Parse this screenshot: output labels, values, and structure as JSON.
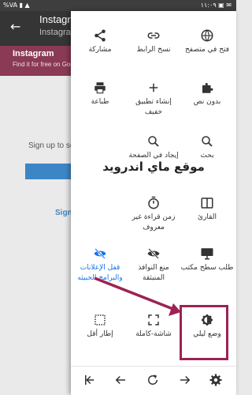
{
  "status_bar": {
    "left": "%VA ▮ ▲",
    "right": "١١:٠٩ ▣ ✉"
  },
  "background": {
    "title": "Instagram",
    "subtitle": "Instagram",
    "banner_title": "Instagram",
    "banner_sub": "Find it for free on Google Play",
    "signup": "Sign up to see",
    "link": "Sign"
  },
  "menu": {
    "items": [
      {
        "label": "مشاركة",
        "icon": "share-icon"
      },
      {
        "label": "نسخ الرابط",
        "icon": "link-icon"
      },
      {
        "label": "فتح في متصفح",
        "icon": "globe-icon"
      },
      {
        "label": "طباعة",
        "icon": "print-icon"
      },
      {
        "label": "إنشاء تطبيق خفيف",
        "icon": "add-icon"
      },
      {
        "label": "بدون نص",
        "icon": "puzzle-icon"
      },
      {
        "label": "إيجاد في الصفحة",
        "icon": "find-icon"
      },
      {
        "label": "بحث",
        "icon": "search-icon"
      },
      {
        "label": "زمن قراءة غير معروف",
        "icon": "timer-icon"
      },
      {
        "label": "القارئ",
        "icon": "reader-icon"
      },
      {
        "label": "قفل الإعلانات والبرامج الخبيثه",
        "icon": "eye-off-icon",
        "accent": "#1a73e8"
      },
      {
        "label": "منع النوافذ المنبثقة",
        "icon": "popup-block-icon"
      },
      {
        "label": "طلب سطح مكتب",
        "icon": "desktop-icon"
      },
      {
        "label": "إطار أقل",
        "icon": "frame-less-icon"
      },
      {
        "label": "شاشة-كاملة",
        "icon": "fullscreen-icon"
      },
      {
        "label": "وضع ليلي",
        "icon": "night-mode-icon"
      }
    ],
    "watermark": "موقع ماي اندرويد"
  },
  "colors": {
    "accent": "#1a73e8",
    "highlight": "#9c2354"
  }
}
